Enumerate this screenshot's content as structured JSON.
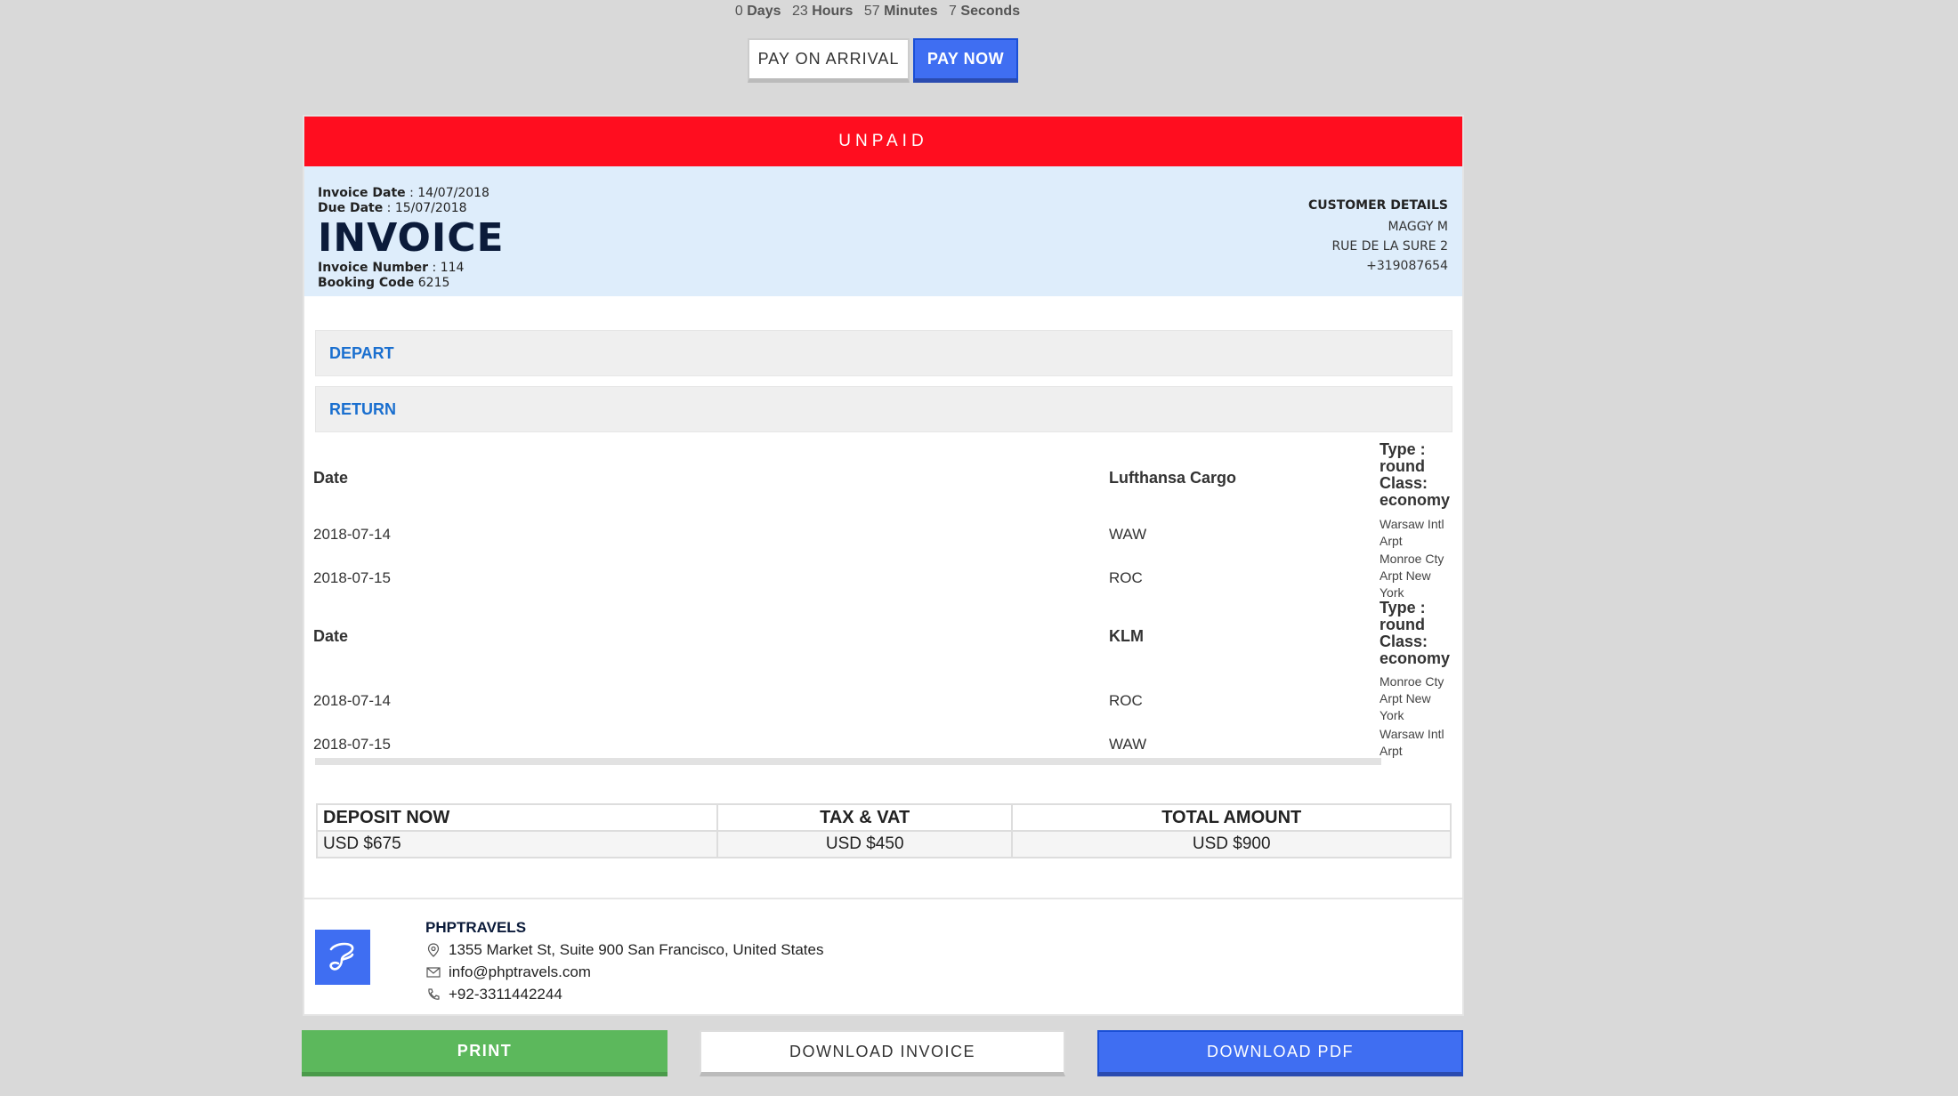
{
  "countdown": {
    "days_value": "0",
    "days_label": "Days",
    "hours_value": "23",
    "hours_label": "Hours",
    "minutes_value": "57",
    "minutes_label": "Minutes",
    "seconds_value": "7",
    "seconds_label": "Seconds"
  },
  "payment": {
    "arrival_label": "PAY ON ARRIVAL",
    "now_label": "PAY NOW"
  },
  "status": "UNPAID",
  "invoice": {
    "date_label": "Invoice Date",
    "date_value": ": 14/07/2018",
    "due_label": "Due Date",
    "due_value": ": 15/07/2018",
    "title": "INVOICE",
    "number_label": "Invoice Number",
    "number_value": ": 114",
    "booking_label": "Booking Code",
    "booking_value": "6215"
  },
  "customer": {
    "title": "CUSTOMER DETAILS",
    "name": "MAGGY M",
    "address": "RUE DE LA SURE 2",
    "phone": "+319087654"
  },
  "sections": {
    "depart": "DEPART",
    "return": "RETURN"
  },
  "flights": [
    {
      "date_header": "Date",
      "airline": "Lufthansa Cargo",
      "type_line1": "Type :",
      "type_line2": "round",
      "class_line1": "Class:",
      "class_line2": "economy",
      "rows": [
        {
          "date": "2018-07-14",
          "code": "WAW",
          "airport": "Warsaw Intl Arpt"
        },
        {
          "date": "2018-07-15",
          "code": "ROC",
          "airport": "Monroe Cty Arpt New York"
        }
      ]
    },
    {
      "date_header": "Date",
      "airline": "KLM",
      "type_line1": "Type :",
      "type_line2": "round",
      "class_line1": "Class:",
      "class_line2": "economy",
      "rows": [
        {
          "date": "2018-07-14",
          "code": "ROC",
          "airport": "Monroe Cty Arpt New York"
        },
        {
          "date": "2018-07-15",
          "code": "WAW",
          "airport": "Warsaw Intl Arpt"
        }
      ]
    }
  ],
  "totals": {
    "headers": [
      "DEPOSIT NOW",
      "TAX & VAT",
      "TOTAL AMOUNT"
    ],
    "values": [
      "USD $675",
      "USD $450",
      "USD $900"
    ]
  },
  "company": {
    "name": "PHPTRAVELS",
    "address": "1355 Market St, Suite 900 San Francisco, United States",
    "email": "info@phptravels.com",
    "phone": "+92-3311442244"
  },
  "actions": {
    "print": "PRINT",
    "download_invoice": "DOWNLOAD INVOICE",
    "download_pdf": "DOWNLOAD PDF"
  },
  "colors": {
    "unpaid": "#ff0d1f",
    "primary": "#3f6ef2",
    "success": "#5cb85c",
    "header_bg": "#deedfb"
  }
}
